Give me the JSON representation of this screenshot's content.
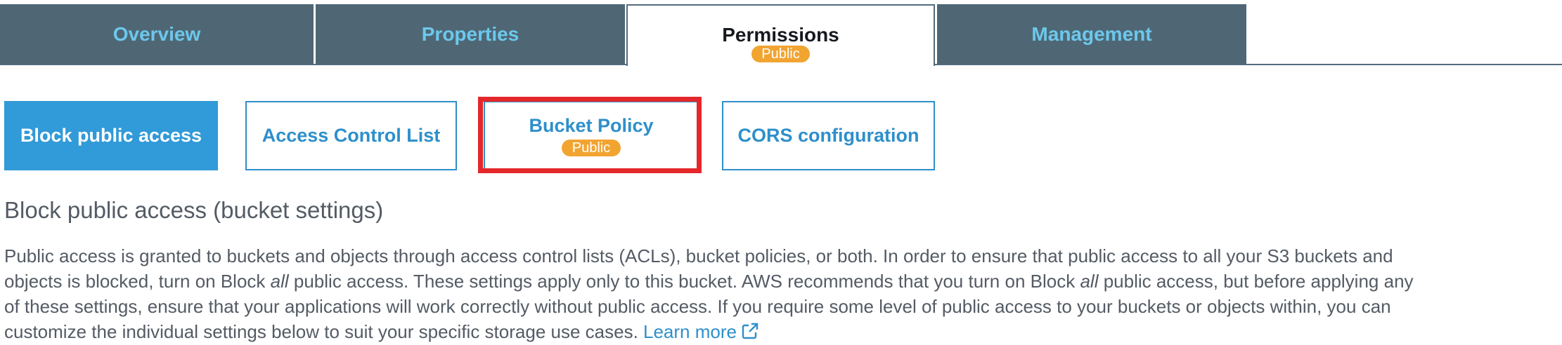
{
  "tabs": [
    {
      "label": "Overview"
    },
    {
      "label": "Properties"
    },
    {
      "label": "Permissions",
      "badge": "Public"
    },
    {
      "label": "Management"
    }
  ],
  "subtabs": [
    {
      "label": "Block public access"
    },
    {
      "label": "Access Control List"
    },
    {
      "label": "Bucket Policy",
      "badge": "Public"
    },
    {
      "label": "CORS configuration"
    }
  ],
  "section": {
    "title": "Block public access (bucket settings)",
    "line1": "Public access is granted to buckets and objects through access control lists (ACLs), bucket policies, or both. In order to ensure that public access to all your S3 buckets and",
    "line2_a": "objects is blocked, turn on Block ",
    "line2_em1": "all",
    "line2_b": " public access. These settings apply only to this bucket. AWS recommends that you turn on Block ",
    "line2_em2": "all",
    "line2_c": " public access, but before applying any",
    "line3": "of these settings, ensure that your applications will work correctly without public access. If you require some level of public access to your buckets or objects within, you can",
    "line4": "customize the individual settings below to suit your specific storage use cases. ",
    "learn_more": "Learn more",
    "learn_more_icon": "external-link-icon"
  },
  "colors": {
    "tab_bg": "#4f6775",
    "tab_text": "#6cc8ec",
    "accent_blue": "#2e8fcb",
    "badge_orange": "#f2a431",
    "highlight_red": "#e4272a",
    "body_text": "#545b64"
  }
}
